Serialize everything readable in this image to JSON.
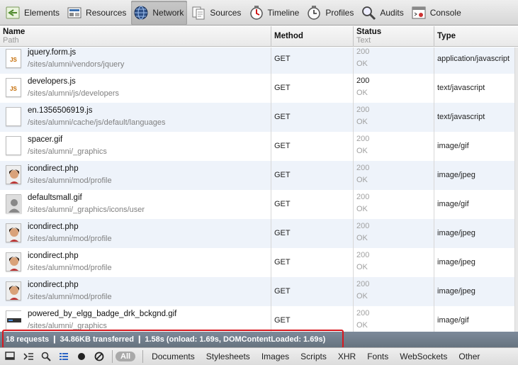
{
  "toolbar": {
    "items": [
      {
        "label": "Elements",
        "icon": "elements-icon"
      },
      {
        "label": "Resources",
        "icon": "resources-icon"
      },
      {
        "label": "Network",
        "icon": "network-icon",
        "active": true
      },
      {
        "label": "Sources",
        "icon": "sources-icon"
      },
      {
        "label": "Timeline",
        "icon": "timeline-icon"
      },
      {
        "label": "Profiles",
        "icon": "profiles-icon"
      },
      {
        "label": "Audits",
        "icon": "audits-icon"
      },
      {
        "label": "Console",
        "icon": "console-icon"
      }
    ]
  },
  "columns": {
    "name": "Name",
    "path": "Path",
    "method": "Method",
    "status": "Status",
    "text": "Text",
    "type": "Type"
  },
  "rows": [
    {
      "name": "jquery.form.js",
      "path": "/sites/alumni/vendors/jquery",
      "method": "GET",
      "status": "200",
      "text": "OK",
      "cached": true,
      "type": "application/javascript",
      "icon": "js-file-icon"
    },
    {
      "name": "developers.js",
      "path": "/sites/alumni/js/developers",
      "method": "GET",
      "status": "200",
      "text": "OK",
      "cached": false,
      "type": "text/javascript",
      "icon": "js-file-icon"
    },
    {
      "name": "en.1356506919.js",
      "path": "/sites/alumni/cache/js/default/languages",
      "method": "GET",
      "status": "200",
      "text": "OK",
      "cached": true,
      "type": "text/javascript",
      "icon": "blank-file-icon"
    },
    {
      "name": "spacer.gif",
      "path": "/sites/alumni/_graphics",
      "method": "GET",
      "status": "200",
      "text": "OK",
      "cached": true,
      "type": "image/gif",
      "icon": "blank-file-icon"
    },
    {
      "name": "icondirect.php",
      "path": "/sites/alumni/mod/profile",
      "method": "GET",
      "status": "200",
      "text": "OK",
      "cached": true,
      "type": "image/jpeg",
      "icon": "avatar-thumbnail-icon"
    },
    {
      "name": "defaultsmall.gif",
      "path": "/sites/alumni/_graphics/icons/user",
      "method": "GET",
      "status": "200",
      "text": "OK",
      "cached": true,
      "type": "image/gif",
      "icon": "default-user-icon"
    },
    {
      "name": "icondirect.php",
      "path": "/sites/alumni/mod/profile",
      "method": "GET",
      "status": "200",
      "text": "OK",
      "cached": true,
      "type": "image/jpeg",
      "icon": "avatar-thumbnail-icon"
    },
    {
      "name": "icondirect.php",
      "path": "/sites/alumni/mod/profile",
      "method": "GET",
      "status": "200",
      "text": "OK",
      "cached": true,
      "type": "image/jpeg",
      "icon": "avatar-thumbnail-icon"
    },
    {
      "name": "icondirect.php",
      "path": "/sites/alumni/mod/profile",
      "method": "GET",
      "status": "200",
      "text": "OK",
      "cached": true,
      "type": "image/jpeg",
      "icon": "avatar-thumbnail-icon"
    },
    {
      "name": "powered_by_elgg_badge_drk_bckgnd.gif",
      "path": "/sites/alumni/_graphics",
      "method": "GET",
      "status": "200",
      "text": "OK",
      "cached": true,
      "type": "image/gif",
      "icon": "badge-thumbnail-icon"
    }
  ],
  "summary": "18 requests  ❙  34.86KB transferred  ❙  1.58s (onload: 1.69s, DOMContentLoaded: 1.69s)",
  "bottombar": {
    "filters": [
      "All",
      "Documents",
      "Stylesheets",
      "Images",
      "Scripts",
      "XHR",
      "Fonts",
      "WebSockets",
      "Other"
    ],
    "active_filter": "All"
  },
  "colors": {
    "highlight": "#d71920",
    "summary_bg": "#6f7c8a",
    "row_alt": "#eef3fa"
  }
}
